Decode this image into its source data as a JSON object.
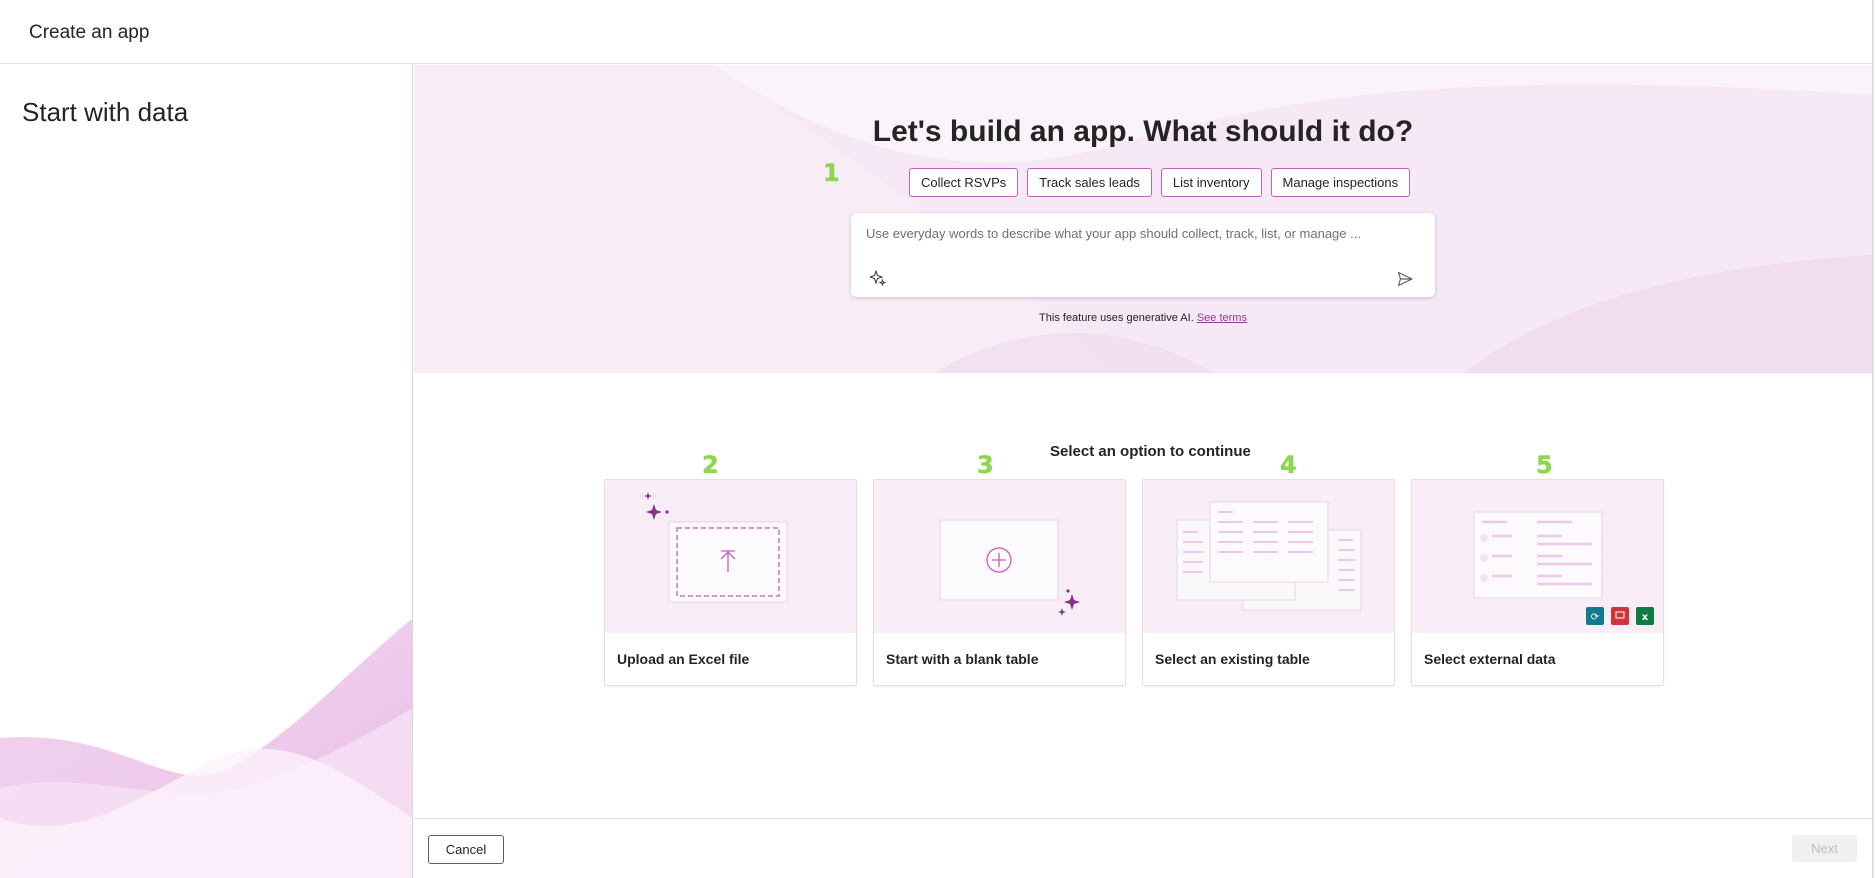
{
  "window": {
    "title": "Create an app"
  },
  "left_panel": {
    "heading": "Start with data"
  },
  "hero": {
    "heading": "Let's build an app. What should it do?",
    "suggestions": [
      "Collect RSVPs",
      "Track sales leads",
      "List inventory",
      "Manage inspections"
    ],
    "prompt": {
      "placeholder": "Use everyday words to describe what your app should collect, track, list, or manage ...",
      "value": ""
    },
    "ai_notice": "This feature uses generative AI.",
    "terms_link": "See terms"
  },
  "markers": [
    "1",
    "2",
    "3",
    "4",
    "5"
  ],
  "options": {
    "heading": "Select an option to continue",
    "cards": [
      {
        "label": "Upload an Excel file",
        "icon": "upload-icon"
      },
      {
        "label": "Start with a blank table",
        "icon": "add-circle-icon"
      },
      {
        "label": "Select an existing table",
        "icon": "tables-icon"
      },
      {
        "label": "Select external data",
        "icon": "external-data-icon"
      }
    ]
  },
  "footer": {
    "cancel": "Cancel",
    "next": "Next"
  },
  "colors": {
    "accent": "#c35fc0",
    "hero_bg": "#f6e8f5",
    "marker": "#8ed64a"
  }
}
